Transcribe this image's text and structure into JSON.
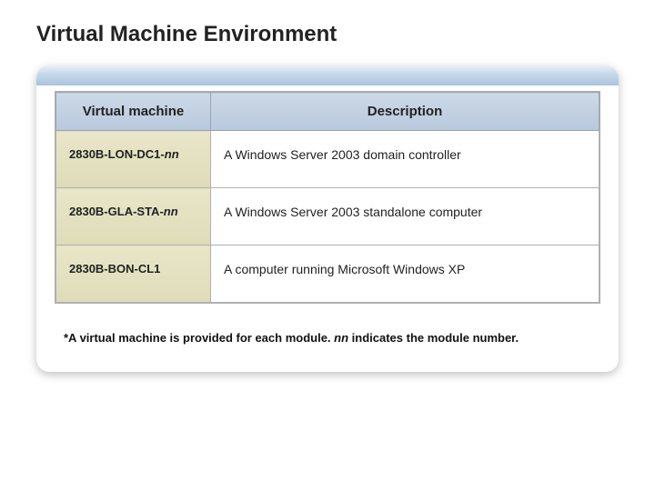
{
  "title": "Virtual Machine Environment",
  "table": {
    "headers": {
      "col1": "Virtual machine",
      "col2": "Description"
    },
    "rows": [
      {
        "name_prefix": "2830B-LON-DC1-",
        "name_suffix": "nn",
        "description": "A Windows Server 2003 domain controller"
      },
      {
        "name_prefix": "2830B-GLA-STA-",
        "name_suffix": "nn",
        "description": "A Windows Server 2003 standalone computer"
      },
      {
        "name_prefix": "2830B-BON-CL1",
        "name_suffix": "",
        "description": "A computer running Microsoft Windows XP"
      }
    ]
  },
  "footnote": {
    "part1": "*A virtual machine is provided for each module.  ",
    "nn": "nn",
    "part2": " indicates the module number."
  }
}
